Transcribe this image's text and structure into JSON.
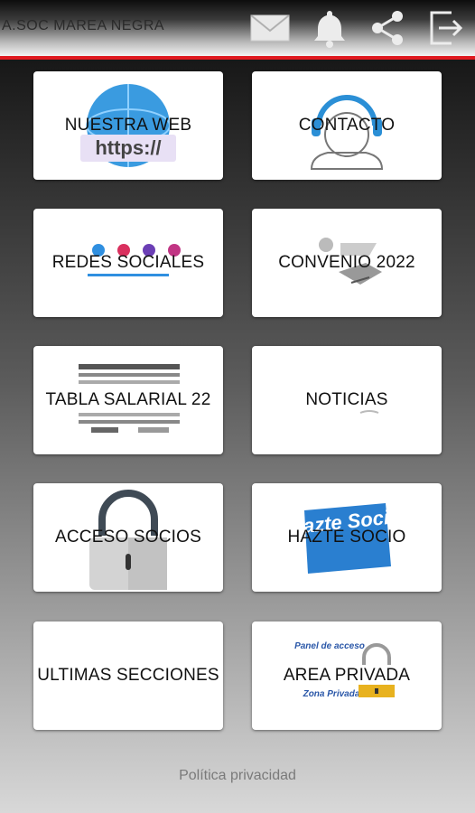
{
  "header": {
    "title": "A.SOC MAREA NEGRA",
    "icons": [
      "mail-icon",
      "bell-icon",
      "share-icon",
      "logout-icon"
    ],
    "accent": "#e0191f"
  },
  "tiles": [
    {
      "label": "NUESTRA WEB",
      "icon": "globe-https-icon",
      "art_text": "https://"
    },
    {
      "label": "CONTACTO",
      "icon": "headset-icon"
    },
    {
      "label": "REDES SOCIALES",
      "icon": "social-networks-icon"
    },
    {
      "label": "CONVENIO 2022",
      "icon": "agreement-icon"
    },
    {
      "label": "TABLA SALARIAL 22",
      "icon": "salary-table-icon"
    },
    {
      "label": "NOTICIAS",
      "icon": "news-icon"
    },
    {
      "label": "ACCESO SOCIOS",
      "icon": "padlock-icon"
    },
    {
      "label": "HAZTE SOCIO",
      "icon": "join-badge-icon",
      "art_text": "Hazte Socio"
    },
    {
      "label": "ULTIMAS SECCIONES",
      "icon": "sections-icon"
    },
    {
      "label": "AREA PRIVADA",
      "icon": "private-area-icon",
      "art_text": [
        "Panel de acceso",
        "Zona Privada"
      ]
    }
  ],
  "footer": {
    "privacy_label": "Política privacidad"
  }
}
